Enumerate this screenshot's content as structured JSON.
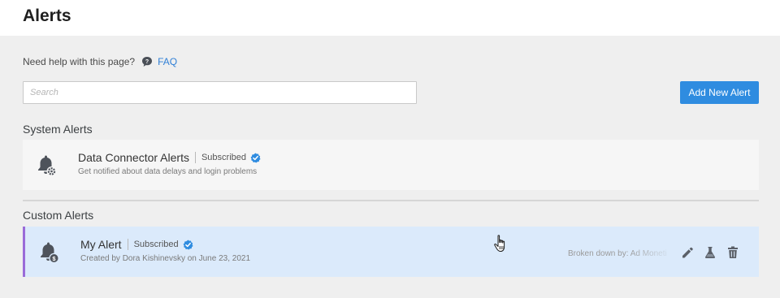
{
  "header": {
    "title": "Alerts"
  },
  "help": {
    "text": "Need help with this page?",
    "faq_label": "FAQ"
  },
  "search": {
    "placeholder": "Search",
    "value": ""
  },
  "toolbar": {
    "add_label": "Add New Alert"
  },
  "sections": {
    "system": {
      "title": "System Alerts",
      "alert": {
        "name": "Data Connector Alerts",
        "status": "Subscribed",
        "description": "Get notified about data delays and login problems",
        "icon": "bell-gear-icon"
      }
    },
    "custom": {
      "title": "Custom Alerts",
      "alert": {
        "name": "My Alert",
        "status": "Subscribed",
        "description": "Created by Dora Kishinevsky on June 23, 2021",
        "breakdown": "Broken down by: Ad Moneti",
        "icon": "bell-dollar-icon"
      }
    }
  },
  "colors": {
    "accent": "#2f8ce0",
    "link": "#2f7fd6",
    "custom_card_bg": "#dbeafb",
    "custom_card_border": "#9a6bd8",
    "check": "#2f8ce0"
  }
}
